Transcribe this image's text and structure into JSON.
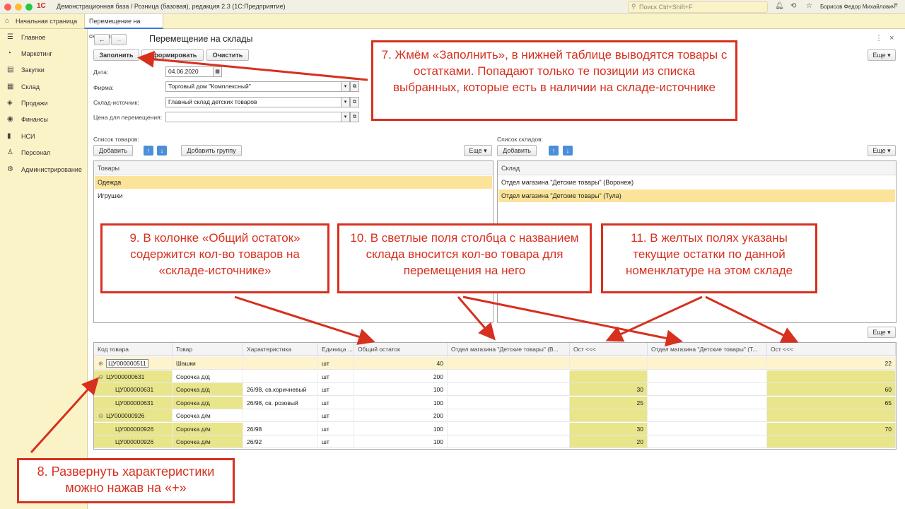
{
  "window": {
    "title": "Демонстрационная база / Розница (базовая), редакция 2.3  (1С:Предприятие)",
    "search_placeholder": "Поиск Ctrl+Shift+F",
    "user": "Борисов Федор Михайлович"
  },
  "tabs": {
    "home": "Начальная страница",
    "active": "Перемещение на склады"
  },
  "sidebar": {
    "items": [
      "Главное",
      "Маркетинг",
      "Закупки",
      "Склад",
      "Продажи",
      "Финансы",
      "НСИ",
      "Персонал",
      "Администрирование"
    ]
  },
  "form": {
    "title": "Перемещение на склады",
    "buttons": {
      "fill": "Заполнить",
      "form": "Сформировать",
      "clear": "Очистить",
      "more": "Еще ▾"
    },
    "date": {
      "label": "Дата:",
      "value": "04.06.2020"
    },
    "firm": {
      "label": "Фирма:",
      "value": "Торговый дом \"Комплексный\""
    },
    "source": {
      "label": "Склад-источник:",
      "value": "Главный склад детских товаров"
    },
    "price": {
      "label": "Цена для перемещения:",
      "value": ""
    }
  },
  "goods_list": {
    "label": "Список товаров:",
    "add": "Добавить",
    "add_group": "Добавить группу",
    "more": "Еще ▾",
    "header": "Товары",
    "rows": [
      "Одежда",
      "Игрушки"
    ]
  },
  "stores_list": {
    "label": "Список складов:",
    "add": "Добавить",
    "more": "Еще ▾",
    "header": "Склад",
    "rows": [
      "Отдел магазина \"Детские товары\" (Воронеж)",
      "Отдел магазина \"Детские товары\" (Тула)"
    ]
  },
  "grid": {
    "more": "Еще ▾",
    "headers": [
      "Код товара",
      "Товар",
      "Характеристика",
      "Единица ...",
      "Общий остаток",
      "Отдел магазина \"Детские товары\" (В...",
      "Ост <<<",
      "Отдел магазина \"Детские товары\" (Т...",
      "Ост <<<"
    ],
    "rows": [
      {
        "code": "ЦУ000000511",
        "toggle": "⊕",
        "goods": "Шашки",
        "char": "",
        "unit": "шт",
        "total": "40",
        "v1": "",
        "o1": "",
        "v2": "",
        "o2": "22"
      },
      {
        "code": "ЦУ000000631",
        "toggle": "⊖",
        "goods": "Сорочка д/д",
        "char": "",
        "unit": "шт",
        "total": "200",
        "v1": "",
        "o1": "",
        "v2": "",
        "o2": ""
      },
      {
        "code": "ЦУ000000631",
        "toggle": "",
        "goods": "Сорочка д/д",
        "char": "26/98, св.коричневый",
        "unit": "шт",
        "total": "100",
        "v1": "",
        "o1": "30",
        "v2": "",
        "o2": "60"
      },
      {
        "code": "ЦУ000000631",
        "toggle": "",
        "goods": "Сорочка д/д",
        "char": "26/98, св. розовый",
        "unit": "шт",
        "total": "100",
        "v1": "",
        "o1": "25",
        "v2": "",
        "o2": "65"
      },
      {
        "code": "ЦУ000000926",
        "toggle": "⊖",
        "goods": "Сорочка д/м",
        "char": "",
        "unit": "шт",
        "total": "200",
        "v1": "",
        "o1": "",
        "v2": "",
        "o2": ""
      },
      {
        "code": "ЦУ000000926",
        "toggle": "",
        "goods": "Сорочка д/м",
        "char": "26/98",
        "unit": "шт",
        "total": "100",
        "v1": "",
        "o1": "30",
        "v2": "",
        "o2": "70"
      },
      {
        "code": "ЦУ000000926",
        "toggle": "",
        "goods": "Сорочка д/м",
        "char": "26/92",
        "unit": "шт",
        "total": "100",
        "v1": "",
        "o1": "20",
        "v2": "",
        "o2": ""
      }
    ]
  },
  "notes": {
    "n7": "7. Жмём «Заполнить», в нижней таблице выводятся товары с остатками. Попадают только те позиции из списка выбранных, которые есть в наличии на складе-источнике",
    "n9": "9. В колонке «Общий остаток» содержится кол-во товаров на «складе-источнике»",
    "n10": "10. В светлые поля столбца с названием склада вносится кол-во товара для перемещения на него",
    "n11": "11. В желтых полях указаны текущие остатки по данной номенклатуре на этом складе",
    "n8": "8. Развернуть характеристики можно нажав на «+»"
  },
  "colors": {
    "accent": "#d7301f",
    "sidebar": "#fbf3c8",
    "yellow_cell": "#e8e58a",
    "selected_row": "#fbe49a"
  }
}
